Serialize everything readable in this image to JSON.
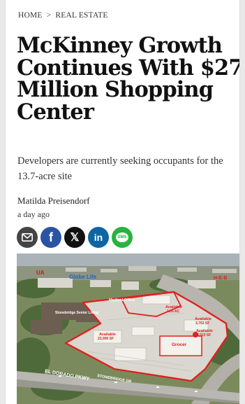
{
  "breadcrumb": {
    "home": "HOME",
    "separator": ">",
    "section": "REAL ESTATE"
  },
  "article": {
    "headline_lines": [
      "McKinney Growth",
      "Continues With $27",
      "Million Shopping",
      "Center"
    ],
    "dek": "Developers are currently seeking occupants for the 13.7-acre site",
    "author": "Matilda Preisendorf",
    "timestamp": "a day ago"
  },
  "share": {
    "facebook_glyph": "f",
    "x_glyph": "𝕏",
    "linkedin_glyph": "in",
    "sms_label": "SMS",
    "icons": [
      "email-icon",
      "facebook-icon",
      "x-icon",
      "linkedin-icon",
      "sms-icon"
    ],
    "colors": {
      "email": "#444444",
      "facebook": "#2a54a3",
      "x": "#111111",
      "linkedin": "#0d66a3",
      "sms": "#27b33e"
    }
  },
  "photo": {
    "labels": {
      "globe_life": "Globe Life",
      "ua": "UA",
      "medical_office": "Medical Office",
      "available_1": "Available",
      "available_1_size": "1.35 AC",
      "available_2": "Available",
      "available_2_size": "3,763 SF",
      "available_3": "Available",
      "available_3_size": "4,523 SF",
      "grocer": "Grocer",
      "available_4": "Available",
      "available_4_size": "23,900 SF",
      "heb": "H-E-B",
      "road_1": "EL DORADO PKWY",
      "road_2": "STONEBRIDGE DR",
      "senior_living": "Stonebridge Senior Living"
    },
    "outline_color": "#e02020"
  }
}
